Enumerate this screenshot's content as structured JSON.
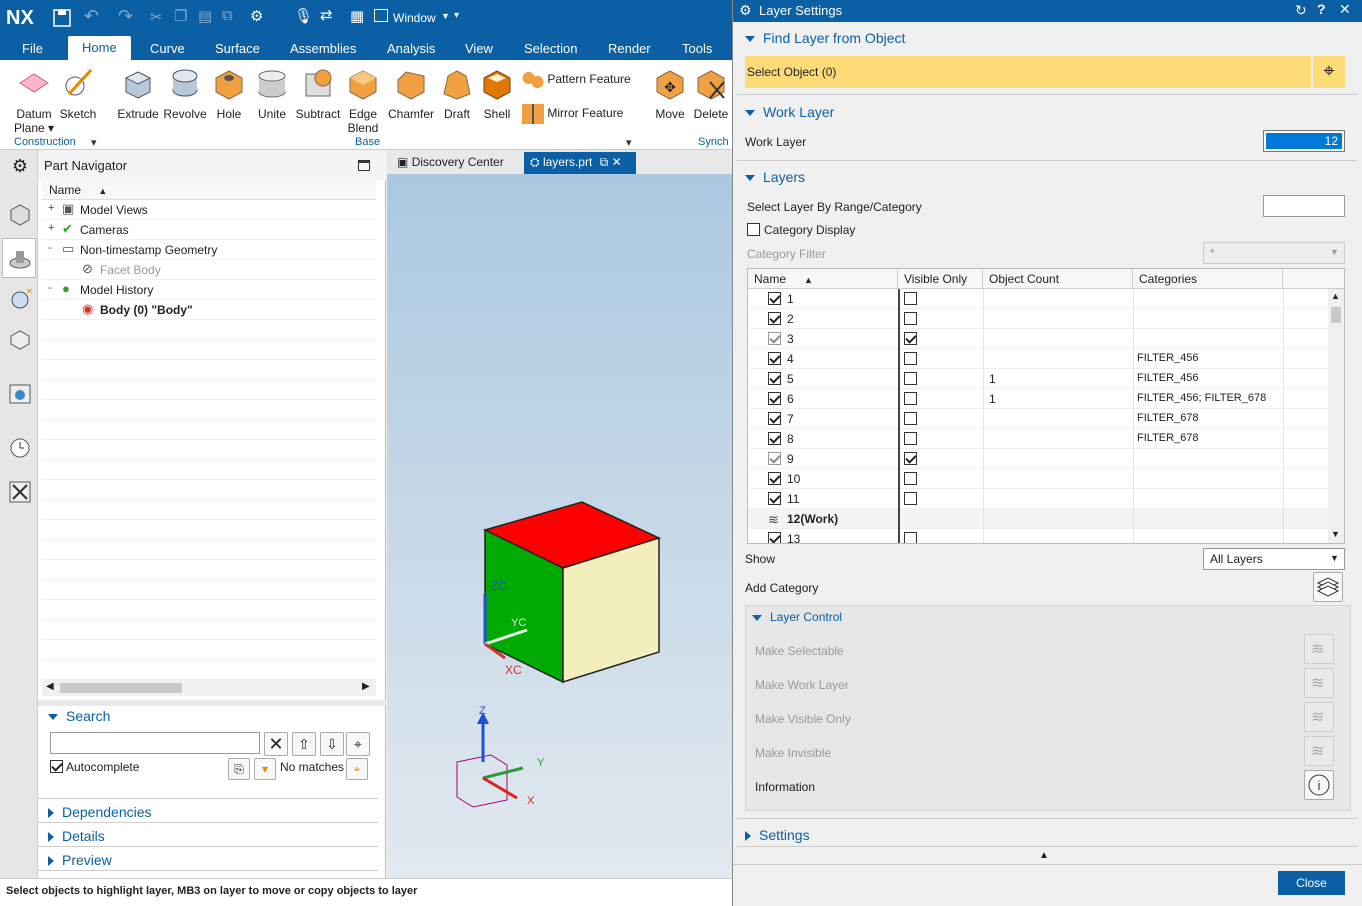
{
  "app": {
    "logo": "NX",
    "window_menu": "Window"
  },
  "menu": [
    "File",
    "Home",
    "Curve",
    "Surface",
    "Assemblies",
    "Analysis",
    "View",
    "Selection",
    "Render",
    "Tools"
  ],
  "ribbon": {
    "buttons": [
      {
        "label": "Datum",
        "label2": "Plane",
        "icon": "datum-plane-icon"
      },
      {
        "label": "Sketch",
        "icon": "sketch-icon"
      },
      {
        "label": "Extrude",
        "icon": "extrude-icon"
      },
      {
        "label": "Revolve",
        "icon": "revolve-icon"
      },
      {
        "label": "Hole",
        "icon": "hole-icon"
      },
      {
        "label": "Unite",
        "icon": "unite-icon"
      },
      {
        "label": "Subtract",
        "icon": "subtract-icon"
      },
      {
        "label": "Edge",
        "label2": "Blend",
        "icon": "edge-blend-icon"
      },
      {
        "label": "Chamfer",
        "icon": "chamfer-icon"
      },
      {
        "label": "Draft",
        "icon": "draft-icon"
      },
      {
        "label": "Shell",
        "icon": "shell-icon"
      },
      {
        "label": "Move",
        "icon": "move-icon"
      },
      {
        "label": "Delete",
        "icon": "delete-icon"
      }
    ],
    "pattern_feature": "Pattern Feature",
    "mirror_feature": "Mirror Feature",
    "groups": {
      "construction": "Construction",
      "base": "Base",
      "synch": "Synch"
    }
  },
  "part_navigator": {
    "title": "Part Navigator",
    "column_name": "Name",
    "items": [
      {
        "label": "Model Views",
        "expander": "+",
        "icon": "model-views-icon"
      },
      {
        "label": "Cameras",
        "expander": "+",
        "icon": "cameras-icon"
      },
      {
        "label": "Non-timestamp Geometry",
        "expander": "-",
        "icon": "folder-icon"
      },
      {
        "label": "Facet Body",
        "expander": "",
        "icon": "facet-body-icon"
      },
      {
        "label": "Model History",
        "expander": "-",
        "icon": "model-history-icon"
      },
      {
        "label": "Body (0) \"Body\"",
        "expander": "",
        "icon": "body-icon"
      }
    ],
    "search_title": "Search",
    "autocomplete": "Autocomplete",
    "no_matches": "No matches",
    "sections": [
      "Dependencies",
      "Details",
      "Preview"
    ]
  },
  "viewport": {
    "tabs": [
      {
        "label": "Discovery Center"
      },
      {
        "label": "layers.prt"
      }
    ],
    "axis_labels": {
      "zc": "ZC",
      "yc": "YC",
      "xc": "XC",
      "z": "Z",
      "y": "Y",
      "x": "X"
    },
    "colors": {
      "top": "#ff0000",
      "left": "#00aa00",
      "right": "#f2efbd"
    }
  },
  "status": "Select objects to highlight layer, MB3 on layer to move or copy objects to layer",
  "dialog": {
    "title": "Layer Settings",
    "find_layer": "Find Layer from Object",
    "select_object": "Select Object (0)",
    "work_layer_section": "Work Layer",
    "work_layer_label": "Work Layer",
    "work_layer_value": "12",
    "layers_section": "Layers",
    "select_by_range": "Select Layer By Range/Category",
    "category_display": "Category Display",
    "category_filter": "Category Filter",
    "category_filter_value": "*",
    "columns": [
      "Name",
      "Visible Only",
      "Object Count",
      "Categories"
    ],
    "rows": [
      {
        "name": "1",
        "sel": true,
        "vis": false,
        "count": "",
        "cat": ""
      },
      {
        "name": "2",
        "sel": true,
        "vis": false,
        "count": "",
        "cat": ""
      },
      {
        "name": "3",
        "sel": true,
        "vis": true,
        "count": "",
        "cat": "",
        "gray": true
      },
      {
        "name": "4",
        "sel": true,
        "vis": false,
        "count": "",
        "cat": "FILTER_456"
      },
      {
        "name": "5",
        "sel": true,
        "vis": false,
        "count": "1",
        "cat": "FILTER_456"
      },
      {
        "name": "6",
        "sel": true,
        "vis": false,
        "count": "1",
        "cat": "FILTER_456; FILTER_678"
      },
      {
        "name": "7",
        "sel": true,
        "vis": false,
        "count": "",
        "cat": "FILTER_678"
      },
      {
        "name": "8",
        "sel": true,
        "vis": false,
        "count": "",
        "cat": "FILTER_678"
      },
      {
        "name": "9",
        "sel": true,
        "vis": true,
        "count": "",
        "cat": "",
        "gray": true
      },
      {
        "name": "10",
        "sel": true,
        "vis": false,
        "count": "",
        "cat": ""
      },
      {
        "name": "11",
        "sel": true,
        "vis": false,
        "count": "",
        "cat": ""
      },
      {
        "name": "12(Work)",
        "work": true,
        "count": "",
        "cat": ""
      },
      {
        "name": "13",
        "sel": true,
        "vis": false,
        "count": "",
        "cat": ""
      }
    ],
    "show_label": "Show",
    "show_value": "All Layers",
    "add_category": "Add Category",
    "layer_control": "Layer Control",
    "make_selectable": "Make Selectable",
    "make_work_layer": "Make Work Layer",
    "make_visible_only": "Make Visible Only",
    "make_invisible": "Make Invisible",
    "information": "Information",
    "settings": "Settings",
    "close": "Close"
  }
}
